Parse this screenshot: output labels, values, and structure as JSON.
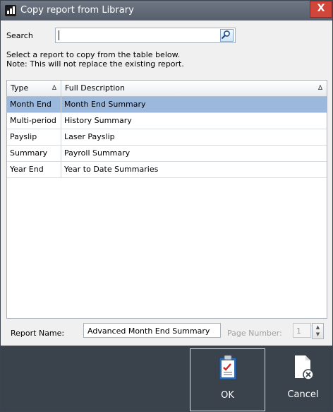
{
  "window": {
    "title": "Copy report from Library",
    "close_label": "X"
  },
  "search": {
    "label": "Search",
    "value": ""
  },
  "instructions": {
    "line1": "Select a report to copy from the table below.",
    "line2": "Note: This will not replace the existing report."
  },
  "table": {
    "columns": [
      {
        "label": "Type",
        "sort": "Δ"
      },
      {
        "label": "Full Description",
        "sort": "Δ"
      }
    ],
    "rows": [
      {
        "type": "Month End",
        "description": "Month End Summary",
        "selected": true
      },
      {
        "type": "Multi-period",
        "description": "History Summary",
        "selected": false
      },
      {
        "type": "Payslip",
        "description": "Laser Payslip",
        "selected": false
      },
      {
        "type": "Summary",
        "description": "Payroll Summary",
        "selected": false
      },
      {
        "type": "Year End",
        "description": "Year to Date Summaries",
        "selected": false
      }
    ]
  },
  "report_name": {
    "label": "Report Name:",
    "value": "Advanced Month End Summary"
  },
  "page_number": {
    "label": "Page Number:",
    "value": "1"
  },
  "buttons": {
    "ok": "OK",
    "cancel": "Cancel"
  },
  "colors": {
    "titlebar": "#5f6873",
    "selected_row": "#9cb8dd",
    "footer": "#3a424c"
  }
}
